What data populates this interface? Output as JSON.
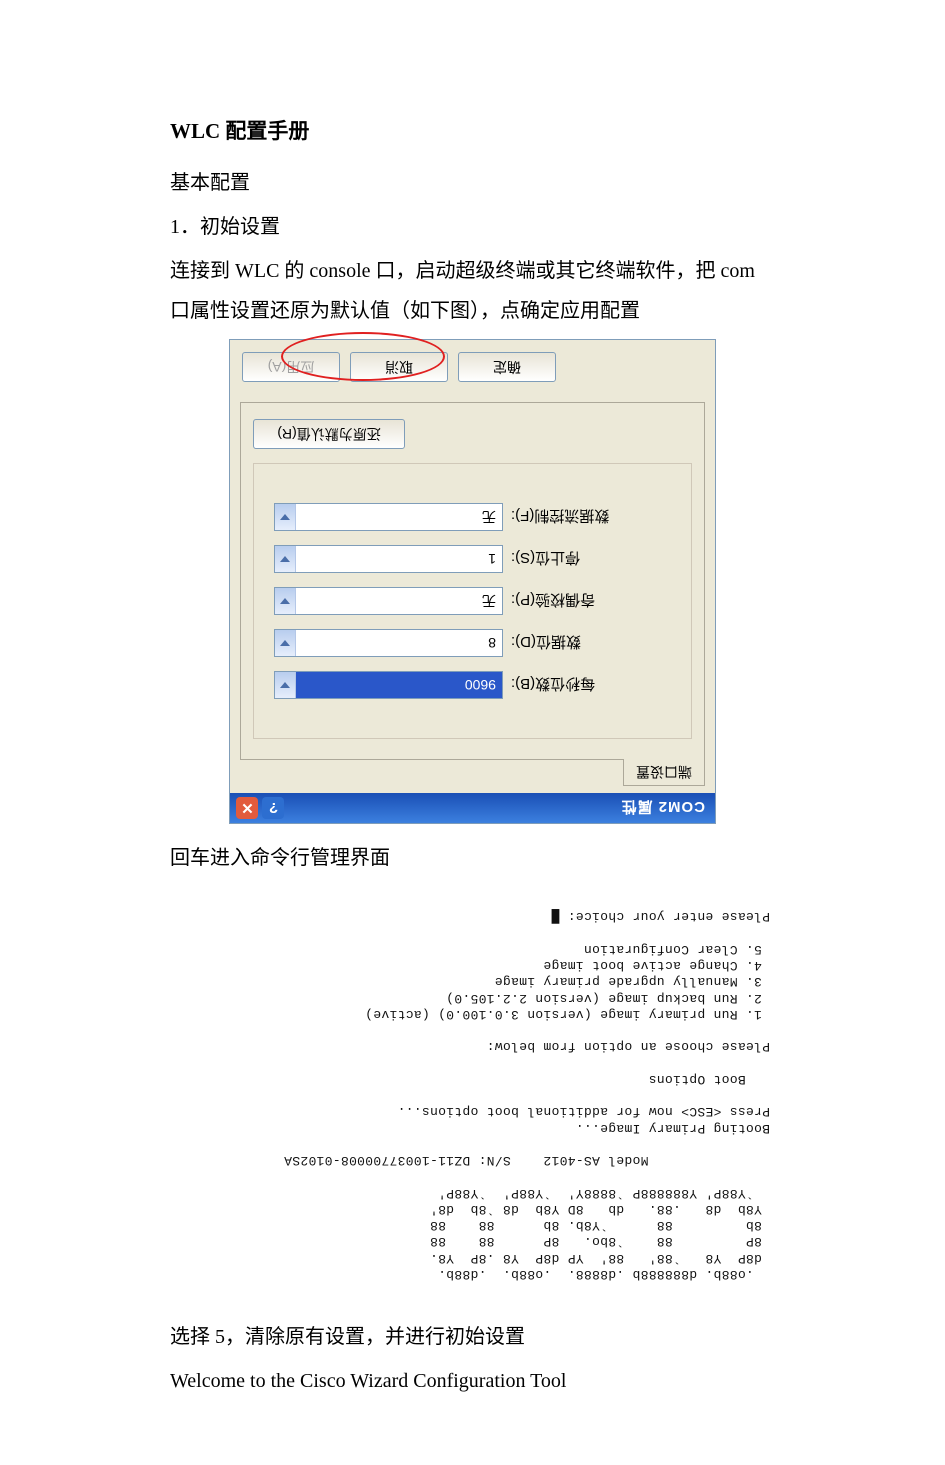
{
  "doc": {
    "title": "WLC 配置手册",
    "subtitle": "基本配置",
    "section1_heading": "1．初始设置",
    "section1_body": "连接到 WLC 的 console 口，启动超级终端或其它终端软件，把 com 口属性设置还原为默认值（如下图），点确定应用配置",
    "after_dialog": "回车进入命令行管理界面",
    "after_cli_1": "选择 5，清除原有设置，并进行初始设置",
    "after_cli_2": "Welcome to the Cisco Wizard Configuration Tool"
  },
  "dialog": {
    "window_title": "COM2 属性",
    "tab_label": "端口设置",
    "fields": {
      "baud": {
        "label": "每秒位数(B):",
        "value": "9600"
      },
      "databits": {
        "label": "数据位(D):",
        "value": "8"
      },
      "parity": {
        "label": "奇偶校验(P):",
        "value": "无"
      },
      "stopbits": {
        "label": "停止位(S):",
        "value": "1"
      },
      "flow": {
        "label": "数据流控制(F):",
        "value": "无"
      }
    },
    "defaults_btn": "还原为默认值(R)",
    "ok_btn": "确定",
    "cancel_btn": "取消",
    "apply_btn": "应用(A)"
  },
  "cli": {
    "text": "  .o88b. d888888b .d8888.  .o88b.  .d88b.\n d8P  Y8   `88'   88'  YP d8P  Y8 .8P  Y8.\n 8P         88    `8bo.   8P      88    88\n 8b         88      `Y8b. 8b      88    88\n Y8b  d8   .88.   db   8D Y8b  d8 `8b  d8'\n  `Y88P' Y888888P `8888Y'  `Y88P'  `Y88P'\n\n               Model AS-4012    S/N: DZ11-10037700008-0102SA\n\nBooting Primary Image...\nPress <ESC> now for additional boot options...\n\n   Boot Options\n\nPlease choose an option from below:\n\n 1. Run primary image (version 3.0.100.0) (active)\n 2. Run backup image (version 2.2.105.0)\n 3. Manually upgrade primary image\n 4. Change active boot image\n 5. Clear Configuration\n\nPlease enter your choice: █"
  }
}
